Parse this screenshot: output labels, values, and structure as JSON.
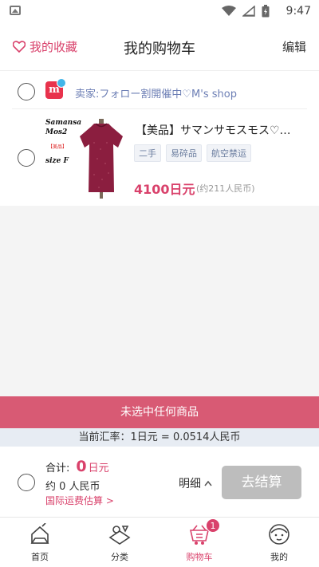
{
  "status_bar": {
    "time": "9:47",
    "icons": [
      "gallery-icon",
      "wifi-icon",
      "signal-icon",
      "battery-charging-icon"
    ]
  },
  "header": {
    "favorites_label": "我的收藏",
    "title": "我的购物车",
    "edit_label": "编辑"
  },
  "seller": {
    "name": "卖家:フォロー割開催中♡M's shop",
    "logo_letter": "m"
  },
  "item": {
    "thumb_text_1": "Samansa",
    "thumb_text_2": "Mos2",
    "thumb_tag": "【美品】",
    "thumb_size": "size F",
    "title": "【美品】サマンサモスモス♡…",
    "tags": [
      "二手",
      "易碎品",
      "航空禁运"
    ],
    "price": "4100日元",
    "price_rmb": "(约211人民币)"
  },
  "notice": {
    "no_selection": "未选中任何商品",
    "exchange_rate": "当前汇率：1日元 = 0.0514人民币"
  },
  "checkout": {
    "total_label": "合计:",
    "total_value": "0",
    "total_unit": "日元",
    "rmb_label": "约 0 人民币",
    "shipping_label": "国际运费估算 >",
    "detail_label": "明细",
    "checkout_button": "去结算"
  },
  "tabs": [
    {
      "label": "首页",
      "icon": "home-icon"
    },
    {
      "label": "分类",
      "icon": "category-icon"
    },
    {
      "label": "购物车",
      "icon": "cart-icon",
      "badge": "1"
    },
    {
      "label": "我的",
      "icon": "profile-icon"
    }
  ],
  "colors": {
    "accent": "#d9416b",
    "notice_bar": "#d85a74",
    "rate_bar": "#e7ecf3",
    "disabled_button": "#bdbdbd",
    "seller_link": "#6d7fb5"
  }
}
